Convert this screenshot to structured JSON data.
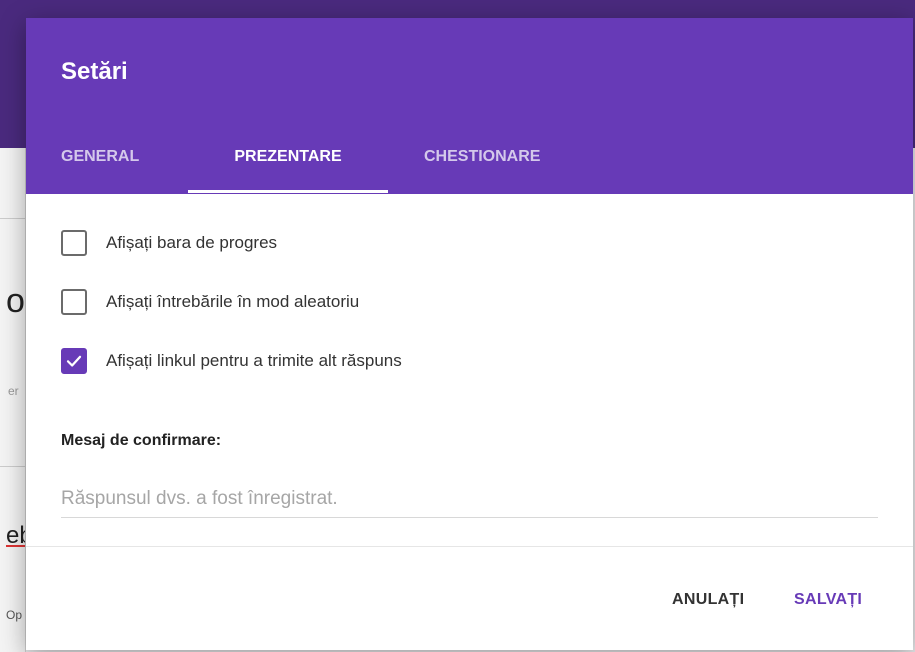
{
  "colors": {
    "accent": "#673ab7",
    "header_bg": "#673ab7",
    "checkbox_checked": "#673ab7",
    "text_primary": "#333333",
    "placeholder": "#a6a6a6"
  },
  "dialog": {
    "title": "Setări",
    "tabs": [
      {
        "label": "GENERAL",
        "active": false
      },
      {
        "label": "PREZENTARE",
        "active": true
      },
      {
        "label": "CHESTIONARE",
        "active": false
      }
    ],
    "options": [
      {
        "label": "Afișați bara de progres",
        "checked": false
      },
      {
        "label": "Afișați întrebările în mod aleatoriu",
        "checked": false
      },
      {
        "label": "Afișați linkul pentru a trimite alt răspuns",
        "checked": true
      }
    ],
    "confirmation": {
      "label": "Mesaj de confirmare:",
      "value": "",
      "placeholder": "Răspunsul dvs. a fost înregistrat."
    },
    "buttons": {
      "cancel": "ANULAȚI",
      "save": "SALVAȚI"
    }
  },
  "background_fragments": [
    "or",
    "er",
    "eb",
    "Op"
  ]
}
